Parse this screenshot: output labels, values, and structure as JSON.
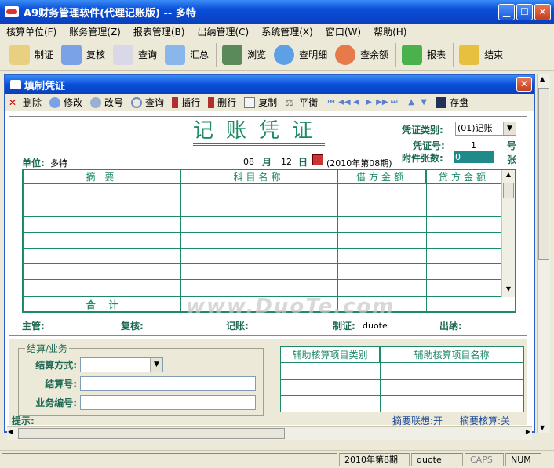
{
  "app": {
    "title": "A9财务管理软件(代理记账版) -- 多特"
  },
  "menubar": [
    "核算单位(F)",
    "账务管理(Z)",
    "报表管理(B)",
    "出纳管理(C)",
    "系统管理(X)",
    "窗口(W)",
    "帮助(H)"
  ],
  "toolbar": [
    {
      "label": "制证",
      "icon": "pencil-doc-icon",
      "color": "#e8d080"
    },
    {
      "label": "复核",
      "icon": "check-doc-icon",
      "color": "#7aa2e6"
    },
    {
      "label": "查询",
      "icon": "search-doc-icon",
      "color": "#d8d8e8"
    },
    {
      "label": "汇总",
      "icon": "summary-icon",
      "color": "#8ab6ee"
    },
    {
      "label": "浏览",
      "icon": "browse-icon",
      "color": "#5a8a5a"
    },
    {
      "label": "查明细",
      "icon": "magnifier-icon",
      "color": "#5ea0e6"
    },
    {
      "label": "查余额",
      "icon": "pie-chart-icon",
      "color": "#e67a4a"
    },
    {
      "label": "报表",
      "icon": "report-icon",
      "color": "#4ab24a"
    },
    {
      "label": "结束",
      "icon": "lock-icon",
      "color": "#e8c040"
    }
  ],
  "child": {
    "title": "填制凭证",
    "actions": [
      {
        "label": "删除",
        "icon": "delete-icon"
      },
      {
        "label": "修改",
        "icon": "edit-icon"
      },
      {
        "label": "改号",
        "icon": "renumber-icon"
      },
      {
        "label": "查询",
        "icon": "query-icon"
      },
      {
        "label": "插行",
        "icon": "insert-row-icon"
      },
      {
        "label": "删行",
        "icon": "delete-row-icon"
      },
      {
        "label": "复制",
        "icon": "copy-icon"
      },
      {
        "label": "平衡",
        "icon": "balance-icon"
      }
    ],
    "save_label": "存盘"
  },
  "voucher": {
    "title": "记账凭证",
    "type_label": "凭证类别:",
    "type_value": "(01)记账",
    "number_label": "凭证号:",
    "number_value": "1",
    "number_unit": "号",
    "attach_label": "附件张数:",
    "attach_value": "0",
    "attach_unit": "张",
    "unit_label": "单位:",
    "unit_value": "多特",
    "date_month": "08",
    "date_month_unit": "月",
    "date_day": "12",
    "date_day_unit": "日",
    "period": "(2010年第08期)",
    "columns": [
      "摘 要",
      "科目名称",
      "借方金额",
      "贷方金额"
    ],
    "total_label": "合    计",
    "supervisor_label": "主管:",
    "review_label": "复核:",
    "bookkeeper_label": "记账:",
    "maker_label": "制证:",
    "maker_value": "duote",
    "cashier_label": "出纳:"
  },
  "settle": {
    "legend": "结算/业务",
    "method_label": "结算方式:",
    "number_label": "结算号:",
    "business_label": "业务编号:"
  },
  "aux": {
    "col1": "辅助核算项目类别",
    "col2": "辅助核算项目名称"
  },
  "hint": {
    "label": "提示:",
    "assoc": "摘要联想:开",
    "aux_status": "摘要核算:关"
  },
  "status": {
    "period": "2010年第8期",
    "user": "duote",
    "caps": "CAPS",
    "num": "NUM"
  },
  "watermark": "www.DuoTe.com"
}
